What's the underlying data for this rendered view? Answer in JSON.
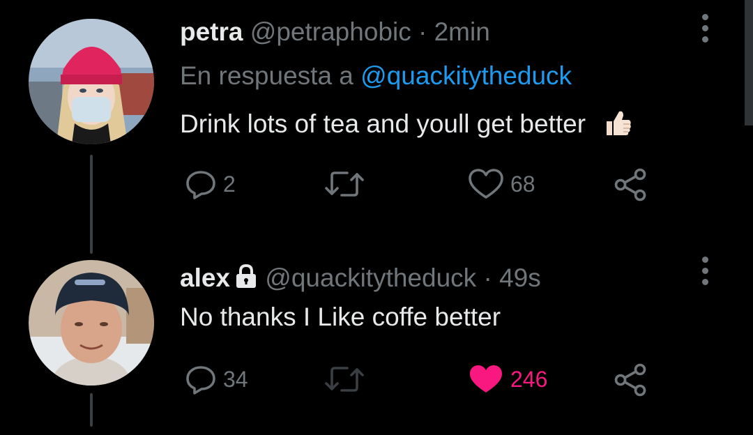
{
  "tweets": [
    {
      "name": "petra",
      "handle": "@petraphobic",
      "separator": "·",
      "time": "2min",
      "reply_prefix": "En respuesta a",
      "reply_mention": "@quackitytheduck",
      "text": "Drink lots of tea and youll get better",
      "reply_count": "2",
      "retweet_count": "",
      "like_count": "68",
      "liked": false
    },
    {
      "name": "alex",
      "handle": "@quackitytheduck",
      "separator": "·",
      "time": "49s",
      "text": "No thanks I Like coffe better",
      "reply_count": "34",
      "retweet_count": "",
      "like_count": "246",
      "liked": true,
      "protected": true
    }
  ],
  "colors": {
    "background": "#000000",
    "text": "#e7e9ea",
    "muted": "#71767b",
    "link": "#1d9bf0",
    "like": "#f91880"
  },
  "icons": [
    "reply-icon",
    "retweet-icon",
    "heart-icon",
    "share-icon",
    "more-icon",
    "lock-icon",
    "thumbs-up-emoji"
  ]
}
